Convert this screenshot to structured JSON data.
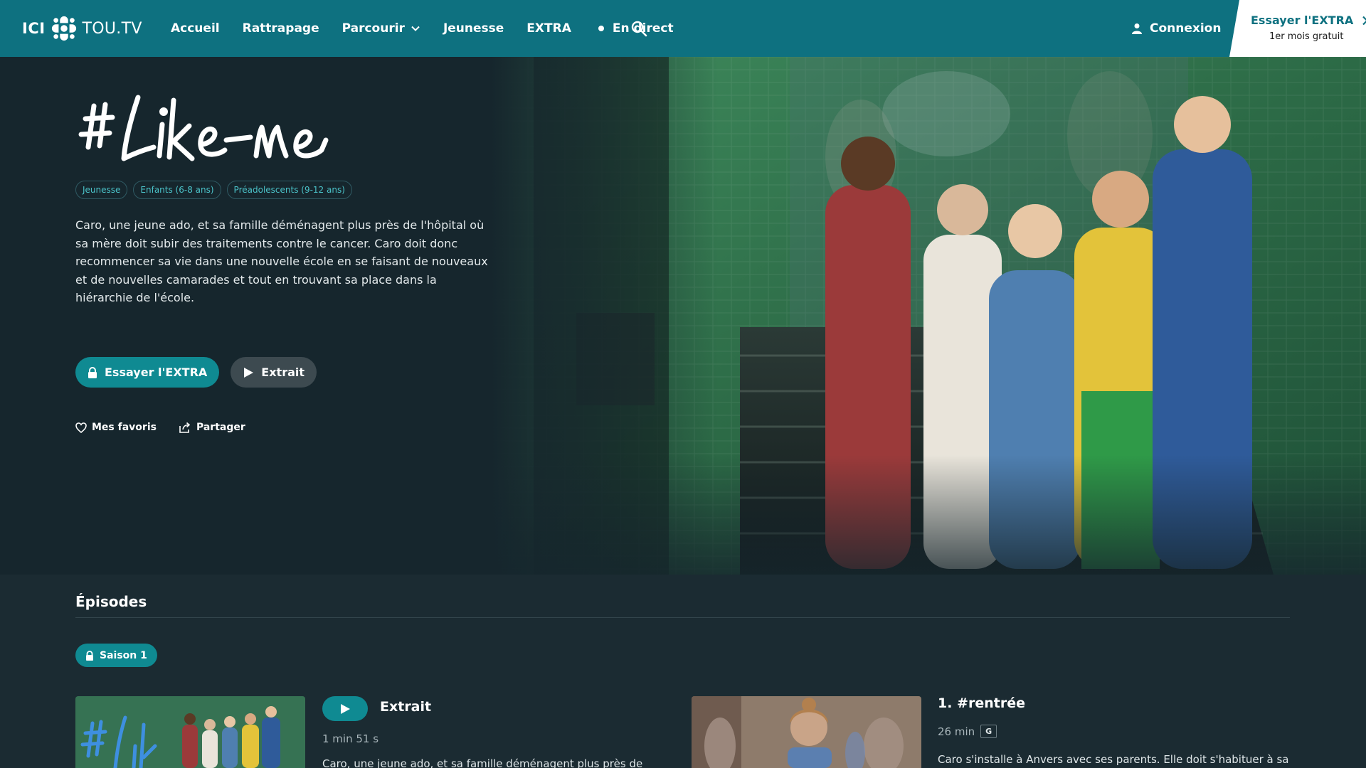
{
  "nav": {
    "logo_ici": "ICI",
    "logo_tou": "TOU.TV",
    "links": [
      "Accueil",
      "Rattrapage",
      "Parcourir",
      "Jeunesse",
      "EXTRA",
      "En direct"
    ],
    "login": "Connexion",
    "cta_main": "Essayer l'EXTRA",
    "cta_sub": "1er mois gratuit"
  },
  "hero": {
    "title_art": "#Like-me",
    "tags": [
      "Jeunesse",
      "Enfants (6-8 ans)",
      "Préadolescents (9-12 ans)"
    ],
    "synopsis": "Caro, une jeune ado, et sa famille déménagent plus près de l'hôpital où sa mère doit subir des traitements contre le cancer. Caro doit donc recommencer sa vie dans une nouvelle école en se faisant de nouveaux et de nouvelles camarades et tout en trouvant sa place dans la hiérarchie de l'école.",
    "btn_extra": "Essayer l'EXTRA",
    "btn_trailer": "Extrait",
    "favorites": "Mes favoris",
    "share": "Partager"
  },
  "episodes": {
    "heading": "Épisodes",
    "season": "Saison 1",
    "items": [
      {
        "title": "Extrait",
        "duration": "1 min 51 s",
        "description": "Caro, une jeune ado, et sa famille déménagent plus près de"
      },
      {
        "title": "1. #rentrée",
        "duration": "26 min",
        "rating": "G",
        "description": "Caro s'installe à Anvers avec ses parents. Elle doit s'habituer à sa"
      }
    ]
  },
  "colors": {
    "nav": "#0e7180",
    "accent": "#0f8a92",
    "tag_text": "#4bc3c9",
    "background": "#182830"
  }
}
